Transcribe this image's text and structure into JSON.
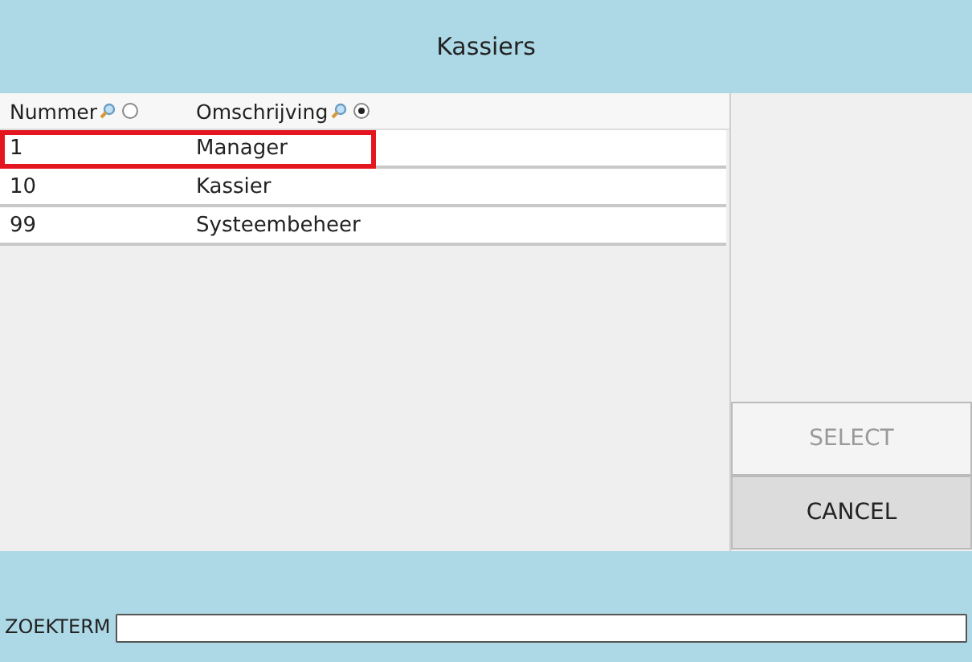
{
  "window": {
    "title": "Kassiers"
  },
  "table": {
    "columns": [
      {
        "label": "Nummer",
        "selected": false
      },
      {
        "label": "Omschrijving",
        "selected": true
      }
    ],
    "rows": [
      {
        "cells": [
          "1",
          "Manager"
        ],
        "selected": true
      },
      {
        "cells": [
          "10",
          "Kassier"
        ],
        "selected": false
      },
      {
        "cells": [
          "99",
          "Systeembeheer"
        ],
        "selected": false
      }
    ]
  },
  "buttons": [
    {
      "label": "SELECT",
      "disabled": true
    },
    {
      "label": "CANCEL",
      "disabled": false
    }
  ],
  "search": {
    "label": "ZOEKTERM"
  }
}
